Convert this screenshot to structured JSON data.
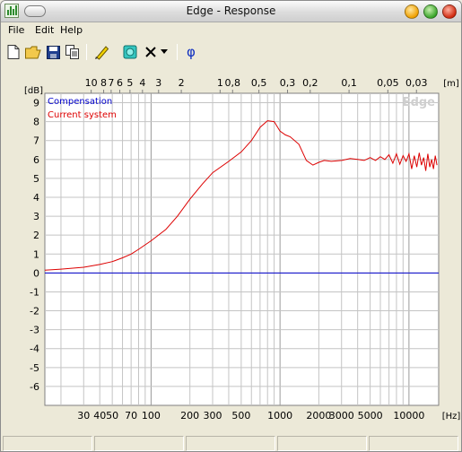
{
  "window": {
    "title": "Edge - Response"
  },
  "menu": [
    "File",
    "Edit",
    "Help"
  ],
  "toolbar": {
    "phi_label": "φ"
  },
  "chart_data": {
    "type": "line",
    "watermark": "Edge",
    "y_unit_label": "[dB]",
    "top_unit_label": "[m]",
    "x_unit_label": "[Hz]",
    "x_scale": "log",
    "xlim": [
      15,
      17000
    ],
    "ylim": [
      -7,
      9.5
    ],
    "grid": true,
    "legend_position": "top-left",
    "y_ticks": [
      9,
      8,
      7,
      6,
      5,
      4,
      3,
      2,
      1,
      0,
      -1,
      -2,
      -3,
      -4,
      -5,
      -6
    ],
    "x_ticks": [
      30,
      40,
      50,
      70,
      100,
      200,
      300,
      500,
      1000,
      2000,
      3000,
      5000,
      10000
    ],
    "x_tick_labels": [
      "30",
      "40",
      "50",
      "70",
      "100",
      "200",
      "300",
      "500",
      "1000",
      "2000",
      "3000",
      "5000",
      "10000"
    ],
    "top_ticks": [
      10,
      8,
      7,
      6,
      5,
      4,
      3,
      2,
      1,
      0.8,
      0.5,
      0.3,
      0.2,
      0.1,
      0.05,
      0.03
    ],
    "top_tick_labels": [
      "10",
      "8",
      "7",
      "6",
      "5",
      "4",
      "3",
      "2",
      "1",
      "0,8",
      "0,5",
      "0,3",
      "0,2",
      "0,1",
      "0,05",
      "0,03"
    ],
    "series": [
      {
        "name": "Compensation",
        "color": "#0000cc",
        "x": [
          15,
          17000
        ],
        "y": [
          0,
          0
        ]
      },
      {
        "name": "Current system",
        "color": "#dd0000",
        "x": [
          15,
          20,
          30,
          40,
          50,
          60,
          70,
          80,
          100,
          130,
          160,
          200,
          250,
          300,
          400,
          500,
          600,
          700,
          800,
          900,
          1000,
          1100,
          1200,
          1400,
          1600,
          1800,
          2000,
          2200,
          2500,
          3000,
          3500,
          4000,
          4500,
          5000,
          5500,
          6000,
          6500,
          7000,
          7500,
          8000,
          8500,
          9000,
          9500,
          10000,
          10500,
          11000,
          11500,
          12000,
          12500,
          13000,
          13500,
          14000,
          14500,
          15000,
          15500,
          16000,
          16500
        ],
        "y": [
          0.15,
          0.2,
          0.3,
          0.45,
          0.6,
          0.8,
          1.0,
          1.25,
          1.7,
          2.3,
          3.0,
          3.9,
          4.7,
          5.3,
          5.9,
          6.4,
          7.0,
          7.7,
          8.05,
          8.0,
          7.5,
          7.3,
          7.2,
          6.8,
          5.95,
          5.7,
          5.85,
          5.95,
          5.9,
          5.95,
          6.05,
          6.0,
          5.95,
          6.1,
          5.95,
          6.15,
          6.0,
          6.25,
          5.8,
          6.3,
          5.75,
          6.2,
          5.9,
          6.3,
          5.5,
          6.2,
          5.6,
          6.35,
          5.7,
          6.1,
          5.4,
          6.3,
          5.6,
          6.0,
          5.5,
          6.2,
          5.7
        ]
      }
    ]
  },
  "status_cells": [
    "",
    "",
    "",
    "",
    ""
  ]
}
